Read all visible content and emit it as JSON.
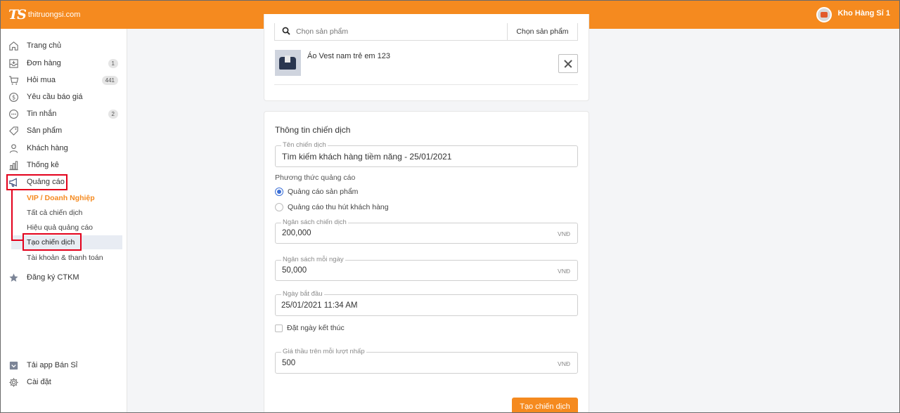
{
  "header": {
    "logo_mark": "TS",
    "logo_text": "thitruongsi.com",
    "account_name": "Kho Hàng Sỉ 1"
  },
  "sidebar": {
    "items": [
      {
        "label": "Trang chủ",
        "icon": "home-icon"
      },
      {
        "label": "Đơn hàng",
        "icon": "inbox-icon",
        "badge": "1"
      },
      {
        "label": "Hỏi mua",
        "icon": "cart-icon",
        "badge": "441"
      },
      {
        "label": "Yêu cầu báo giá",
        "icon": "dollar-icon"
      },
      {
        "label": "Tin nhắn",
        "icon": "chat-icon",
        "badge": "2"
      },
      {
        "label": "Sản phẩm",
        "icon": "tag-icon"
      },
      {
        "label": "Khách hàng",
        "icon": "user-icon"
      },
      {
        "label": "Thống kê",
        "icon": "chart-icon"
      },
      {
        "label": "Quảng cáo",
        "icon": "megaphone-icon"
      }
    ],
    "sub_items": [
      {
        "label": "VIP / Doanh Nghiệp"
      },
      {
        "label": "Tất cả chiến dịch"
      },
      {
        "label": "Hiệu quả quảng cáo"
      },
      {
        "label": "Tạo chiến dịch"
      },
      {
        "label": "Tài khoản & thanh toán"
      }
    ],
    "promo": {
      "label": "Đăng ký CTKM",
      "icon": "star-icon"
    },
    "bottom": [
      {
        "label": "Tải app Bán Sỉ",
        "icon": "download-icon"
      },
      {
        "label": "Cài đặt",
        "icon": "gear-icon"
      }
    ]
  },
  "product_card": {
    "search_placeholder": "Chọn sản phẩm",
    "search_button": "Chọn sản phẩm",
    "product_name": "Áo Vest nam trẻ em 123"
  },
  "campaign": {
    "title": "Thông tin chiến dịch",
    "name_label": "Tên chiến dịch",
    "name_value": "Tìm kiếm khách hàng tiềm năng - 25/01/2021",
    "method_label": "Phương thức quảng cáo",
    "method_options": [
      "Quảng cáo sản phẩm",
      "Quảng cáo thu hút khách hàng"
    ],
    "selected_method": "Quảng cáo sản phẩm",
    "budget_label": "Ngân sách chiến dịch",
    "budget_value": "200,000",
    "daily_budget_label": "Ngân sách mỗi ngày",
    "daily_budget_value": "50,000",
    "start_label": "Ngày bắt đầu",
    "start_value": "25/01/2021 11:34 AM",
    "end_checkbox_label": "Đặt ngày kết thúc",
    "bid_label": "Giá thầu trên mỗi lượt nhấp",
    "bid_value": "500",
    "currency": "VNĐ",
    "submit_label": "Tạo chiến dịch"
  },
  "colors": {
    "brand_orange": "#f58a1f",
    "highlight_red": "#e3001b",
    "radio_blue": "#3b6fd6"
  }
}
